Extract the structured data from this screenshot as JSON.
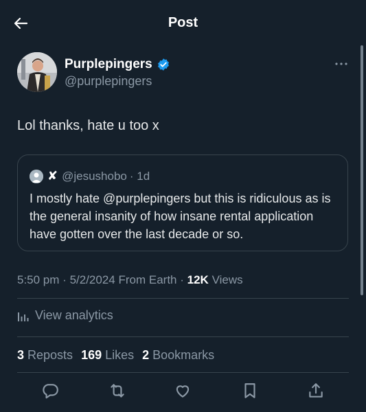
{
  "header": {
    "title": "Post"
  },
  "author": {
    "name": "Purplepingers",
    "handle": "@purplepingers"
  },
  "post": {
    "text": "Lol thanks, hate u too x"
  },
  "quote": {
    "handle": "@jesushobo",
    "age": "· 1d",
    "text": "I mostly hate @purplepingers but this is ridiculous as is the general insanity of how insane rental application have gotten over the last decade or so."
  },
  "meta": {
    "time": "5:50 pm",
    "date": "5/2/2024",
    "source": "From Earth",
    "views_count": "12K",
    "views_label": "Views"
  },
  "analytics": {
    "label": "View analytics"
  },
  "stats": {
    "reposts_count": "3",
    "reposts_label": "Reposts",
    "likes_count": "169",
    "likes_label": "Likes",
    "bookmarks_count": "2",
    "bookmarks_label": "Bookmarks"
  },
  "icons": {
    "back": "back-arrow-icon",
    "verified": "verified-badge-icon",
    "more": "more-options-icon",
    "reply": "reply-icon",
    "repost": "repost-icon",
    "like": "heart-icon",
    "bookmark": "bookmark-icon",
    "share": "share-icon"
  },
  "colors": {
    "background": "#15202b",
    "text": "#e7e9ea",
    "muted": "#8b98a5",
    "accent": "#1d9bf0",
    "border": "#38444d"
  }
}
